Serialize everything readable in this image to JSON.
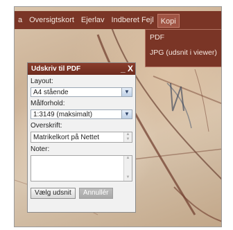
{
  "menubar": {
    "items": [
      {
        "label": "a"
      },
      {
        "label": "Oversigtskort"
      },
      {
        "label": "Ejerlav"
      },
      {
        "label": "Indberet Fejl"
      },
      {
        "label": "Kopi"
      }
    ]
  },
  "kopi_menu": {
    "items": [
      {
        "label": "PDF"
      },
      {
        "label": "JPG (udsnit i viewer)"
      }
    ]
  },
  "dialog": {
    "title": "Udskriv til PDF",
    "minimize_glyph": "_",
    "close_glyph": "X",
    "layout_label": "Layout:",
    "layout_value": "A4 stående",
    "scale_label": "Målforhold:",
    "scale_value": "1:3149 (maksimalt)",
    "heading_label": "Overskrift:",
    "heading_value": "Matrikelkort på Nettet",
    "notes_label": "Noter:",
    "notes_value": "",
    "select_button": "Vælg udsnit",
    "cancel_button": "Annullér"
  },
  "icons": {
    "dropdown_arrow": "chevron-down-icon",
    "minimize": "minimize-icon",
    "close": "close-icon"
  },
  "colors": {
    "menubar_bg": "#7a3526",
    "dialog_title_bg": "#7a3526",
    "map_bg": "#d2b99d"
  }
}
